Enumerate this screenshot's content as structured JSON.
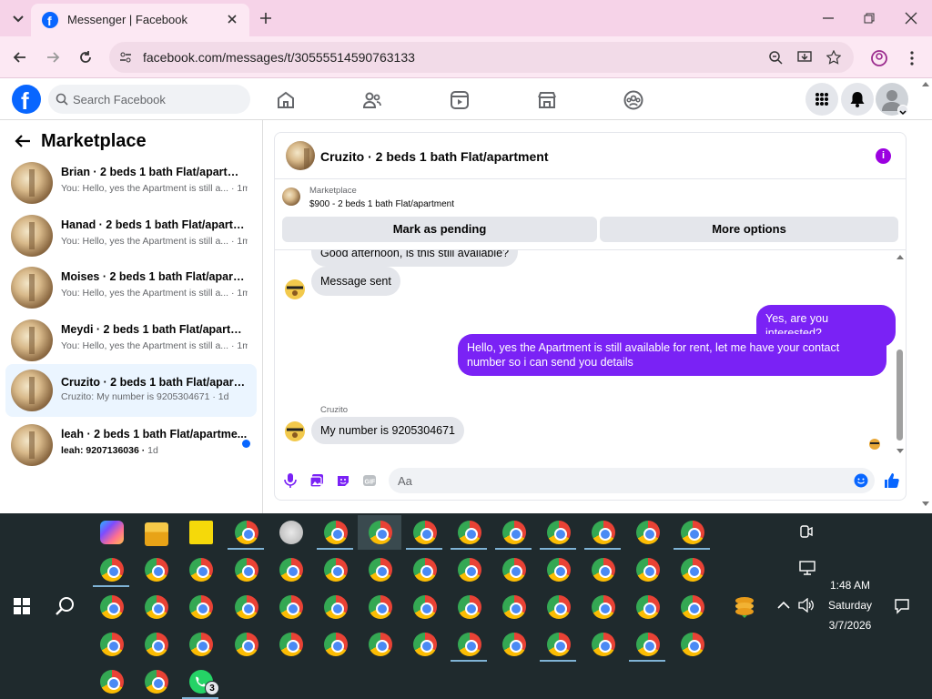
{
  "browser": {
    "tab_title": "Messenger | Facebook",
    "url": "facebook.com/messages/t/30555514590763133"
  },
  "fb": {
    "search_placeholder": "Search Facebook"
  },
  "sidebar": {
    "title": "Marketplace",
    "conversations": [
      {
        "title": "Brian · 2 beds 1 bath Flat/apartment",
        "preview": "You: Hello, yes the Apartment is still a...",
        "time": "1m",
        "active": false,
        "unread": false
      },
      {
        "title": "Hanad · 2 beds 1 bath Flat/apartm...",
        "preview": "You: Hello, yes the Apartment is still a...",
        "time": "1m",
        "active": false,
        "unread": false
      },
      {
        "title": "Moises · 2 beds 1 bath Flat/apartm...",
        "preview": "You: Hello, yes the Apartment is still a...",
        "time": "1m",
        "active": false,
        "unread": false
      },
      {
        "title": "Meydi · 2 beds 1 bath Flat/apartm...",
        "preview": "You: Hello, yes the Apartment is still a...",
        "time": "1m",
        "active": false,
        "unread": false
      },
      {
        "title": "Cruzito · 2 beds 1 bath Flat/apartm...",
        "preview": "Cruzito: My number is 9205304671",
        "time": "1d",
        "active": true,
        "unread": false
      },
      {
        "title": "leah · 2 beds 1 bath Flat/apartme...",
        "preview": "leah: 9207136036",
        "time": "1d",
        "active": false,
        "unread": true
      }
    ]
  },
  "chat": {
    "header_title": "Cruzito · 2 beds 1 bath Flat/apartment",
    "listing_label": "Marketplace",
    "listing_detail": "$900 - 2 beds 1 bath Flat/apartment",
    "mark_pending_label": "Mark as pending",
    "more_options_label": "More options",
    "messages": {
      "partial": "Good afternoon, is this still available?",
      "m1": "Message sent",
      "m2": "Yes, are you interested?",
      "m3": "Hello, yes the Apartment is still available for rent, let me have your contact number so i can send you details",
      "sender_name": "Cruzito",
      "m4": "My number is 9205304671"
    },
    "composer_placeholder": "Aa"
  },
  "taskbar": {
    "time": "1:48 AM",
    "day": "Saturday",
    "date": "3/7/2026",
    "whatsapp_badge": "3"
  },
  "colors": {
    "fb_blue": "#0866ff",
    "messenger_purple": "#7a22f5",
    "chrome_bg": "#f6d3e8",
    "taskbar_bg": "#1f2a2d"
  }
}
